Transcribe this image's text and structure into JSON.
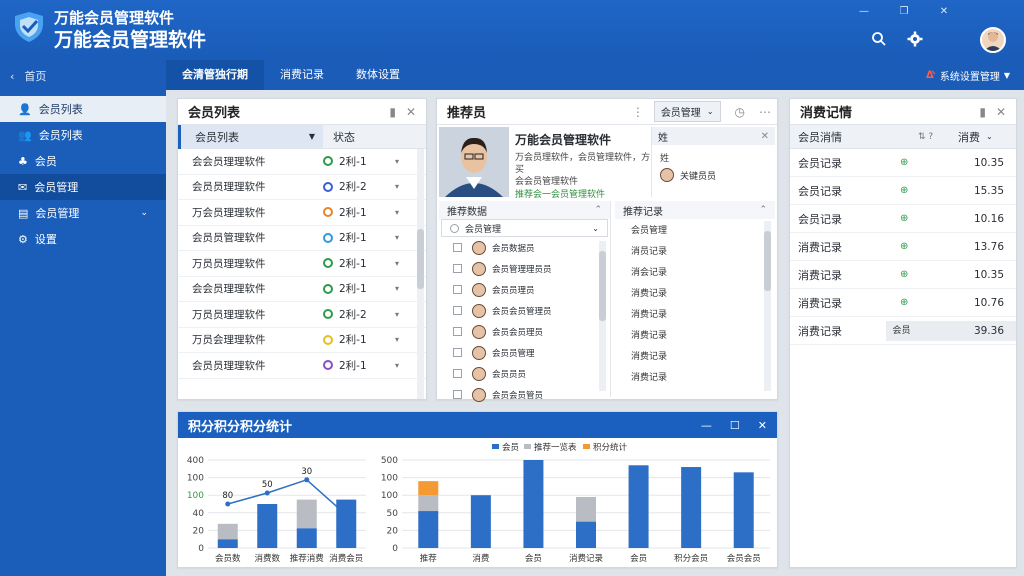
{
  "app": {
    "title1": "万能会员管理软件",
    "title2": "万能会员管理软件"
  },
  "nav": {
    "home": "首页",
    "tabs": [
      "会清管独行期",
      "消费记录",
      "数体设置"
    ],
    "user": "系统设置管理"
  },
  "sidebar": {
    "items": [
      "会员列表",
      "会员列表",
      "会员",
      "会员管理",
      "会员管理",
      "设置"
    ]
  },
  "member_list": {
    "title": "会员列表",
    "col1": "会员列表",
    "col2": "状态",
    "rows": [
      {
        "name": "会会员理理软件",
        "code": "2利-1",
        "color": "#2e9b4a"
      },
      {
        "name": "会员员理理软件",
        "code": "2利-2",
        "color": "#3b5fd1"
      },
      {
        "name": "万会员理理软件",
        "code": "2利-1",
        "color": "#e8842b"
      },
      {
        "name": "会员员管理软件",
        "code": "2利-1",
        "color": "#2f9bd8"
      },
      {
        "name": "万员员理理软件",
        "code": "2利-1",
        "color": "#2e9b4a"
      },
      {
        "name": "会会员理理软件",
        "code": "2利-1",
        "color": "#2e9b4a"
      },
      {
        "name": "万员员理理软件",
        "code": "2利-2",
        "color": "#2e9b4a"
      },
      {
        "name": "万员会理理软件",
        "code": "2利-1",
        "color": "#e6c020"
      },
      {
        "name": "会员员理理软件",
        "code": "2利-1",
        "color": "#8a4fc7"
      }
    ]
  },
  "member_detail": {
    "title": "推荐员",
    "dropdown": "会员管理",
    "name": "万能会员管理软件",
    "desc1": "万会员理软件，会员管理软件，方买",
    "desc2": "会会员管理软件",
    "desc3": "推荐会一会员管理软件",
    "side_head": "姓",
    "side_label": "姓",
    "side_person": "关键员员",
    "list_title": "推荐数据",
    "list_search": "会员管理",
    "list_items": [
      "会员数据员",
      "会员管理理员员",
      "会员员理员",
      "会员会员管理员",
      "会员会员理员",
      "会员员管理",
      "会员员员",
      "会员会员管员"
    ],
    "records_title": "推荐记录",
    "records": [
      "会员管理",
      "消员记录",
      "消会记录",
      "消费记录",
      "消费记录",
      "消费记录",
      "消费记录",
      "消费记录"
    ]
  },
  "consumption": {
    "title": "消费记情",
    "col1": "会员消情",
    "col2": "消费",
    "rows": [
      {
        "label": "会员记录",
        "value": "10.35"
      },
      {
        "label": "会员记录",
        "value": "15.35"
      },
      {
        "label": "会员记录",
        "value": "10.16"
      },
      {
        "label": "消费记录",
        "value": "13.76"
      },
      {
        "label": "消费记录",
        "value": "10.35"
      },
      {
        "label": "消费记录",
        "value": "10.76"
      },
      {
        "label": "消费记录",
        "value": "39.36"
      }
    ],
    "last_tag": "会员"
  },
  "stats": {
    "title": "积分积分积分统计"
  },
  "chart_data": [
    {
      "type": "bar",
      "ylim": [
        0,
        400
      ],
      "yticks": [
        "400",
        "100",
        "100",
        "40",
        "20",
        "0"
      ],
      "categories": [
        "会员数",
        "消费数",
        "推荐消费",
        "消费会员"
      ],
      "series": [
        {
          "values": [
            40,
            200,
            90,
            220
          ],
          "color": "#2d6fc6"
        },
        {
          "values": [
            70,
            0,
            130,
            0
          ],
          "color": "#b9bcc2"
        }
      ],
      "line": [
        200,
        250,
        310,
        150
      ],
      "annotations": [
        "80",
        "50",
        "30",
        ""
      ]
    },
    {
      "type": "bar",
      "ylim": [
        0,
        500
      ],
      "yticks": [
        "500",
        "100",
        "100",
        "50",
        "20",
        "0"
      ],
      "legend": [
        "会员",
        "推荐一览表",
        "积分统计"
      ],
      "categories": [
        "推荐",
        "消费",
        "会员",
        "消费记录",
        "会员",
        "积分会员",
        "会员会员"
      ],
      "series": [
        {
          "values": [
            210,
            300,
            520,
            150,
            470,
            460,
            430
          ],
          "color": "#2d6fc6"
        },
        {
          "values": [
            90,
            0,
            0,
            140,
            0,
            0,
            0
          ],
          "color": "#b9bcc2"
        },
        {
          "values": [
            80,
            0,
            0,
            0,
            0,
            0,
            0
          ],
          "color": "#f39a32"
        }
      ]
    }
  ]
}
